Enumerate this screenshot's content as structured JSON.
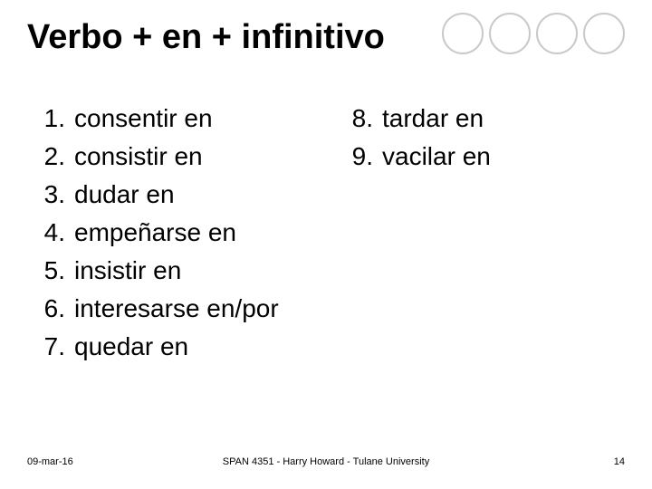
{
  "title": "Verbo + en + infinitivo",
  "left_items": [
    {
      "n": "1.",
      "t": "consentir en"
    },
    {
      "n": "2.",
      "t": "consistir en"
    },
    {
      "n": "3.",
      "t": "dudar en"
    },
    {
      "n": "4.",
      "t": "empeñarse en"
    },
    {
      "n": "5.",
      "t": "insistir en"
    },
    {
      "n": "6.",
      "t": "interesarse en/por"
    },
    {
      "n": "7.",
      "t": "quedar en"
    }
  ],
  "right_items": [
    {
      "n": "8.",
      "t": "tardar en"
    },
    {
      "n": "9.",
      "t": "vacilar en"
    }
  ],
  "footer": {
    "date": "09-mar-16",
    "center": "SPAN 4351 - Harry Howard - Tulane University",
    "page": "14"
  }
}
